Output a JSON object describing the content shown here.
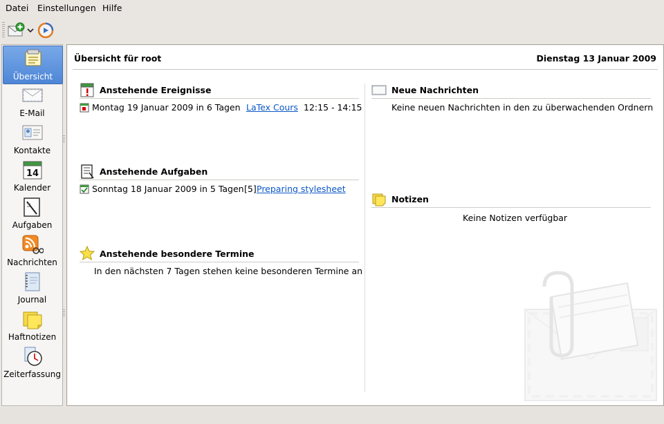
{
  "menubar": {
    "items": [
      {
        "label": "Datei"
      },
      {
        "label": "Einstellungen"
      },
      {
        "label": "Hilfe"
      }
    ]
  },
  "toolbar": {
    "new_mail_icon": "new-mail-icon",
    "sync_icon": "sync-icon"
  },
  "sidebar": {
    "items": [
      {
        "label": "Übersicht",
        "icon": "summary-icon",
        "active": true
      },
      {
        "label": "E-Mail",
        "icon": "mail-icon"
      },
      {
        "label": "Kontakte",
        "icon": "contacts-icon"
      },
      {
        "label": "Kalender",
        "icon": "calendar-icon",
        "calendar_day": "14"
      },
      {
        "label": "Aufgaben",
        "icon": "tasks-icon"
      },
      {
        "label": "Nachrichten",
        "icon": "feeds-icon"
      },
      {
        "label": "Journal",
        "icon": "journal-icon"
      },
      {
        "label": "Haftnotizen",
        "icon": "sticky-notes-icon"
      },
      {
        "label": "Zeiterfassung",
        "icon": "time-tracker-icon"
      }
    ]
  },
  "main": {
    "title": "Übersicht für root",
    "date": "Dienstag 13 Januar 2009",
    "events": {
      "title": "Anstehende Ereignisse",
      "items": [
        {
          "date": "Montag 19 Januar 2009 in 6 Tagen",
          "summary": "LaTex Cours",
          "time": "12:15 - 14:15"
        }
      ]
    },
    "todos": {
      "title": "Anstehende Aufgaben",
      "items": [
        {
          "date": "Sonntag 18 Januar 2009 in 5 Tagen",
          "priority": "[5]",
          "summary": "Preparing stylesheet"
        }
      ]
    },
    "special_dates": {
      "title": "Anstehende besondere Termine",
      "empty_text": "In den nächsten 7 Tagen stehen keine besonderen Termine an"
    },
    "news": {
      "title": "Neue Nachrichten",
      "empty_text": "Keine neuen Nachrichten in den zu überwachenden Ordnern"
    },
    "notes": {
      "title": "Notizen",
      "empty_text": "Keine Notizen verfügbar"
    }
  },
  "colors": {
    "accent": "#4e86d6",
    "link": "#0b57c4",
    "window_bg": "#e9e6e2"
  }
}
